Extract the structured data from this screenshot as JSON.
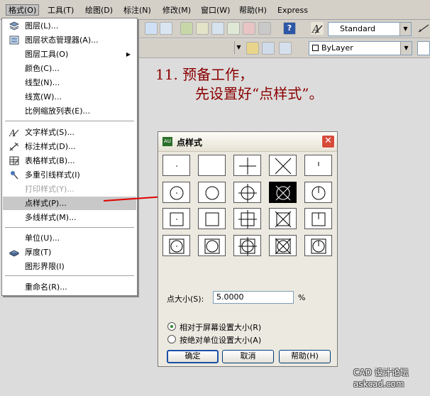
{
  "menubar": {
    "items": [
      {
        "label": "格式(O)"
      },
      {
        "label": "工具(T)"
      },
      {
        "label": "绘图(D)"
      },
      {
        "label": "标注(N)"
      },
      {
        "label": "修改(M)"
      },
      {
        "label": "窗口(W)"
      },
      {
        "label": "帮助(H)"
      },
      {
        "label": "Express"
      }
    ]
  },
  "toolbar": {
    "text_style": "Standard",
    "color": "ByLayer"
  },
  "format_menu": {
    "items": [
      {
        "label": "图层(L)...",
        "icon": "layers-icon"
      },
      {
        "label": "图层状态管理器(A)...",
        "icon": "layer-state-icon"
      },
      {
        "label": "图层工具(O)",
        "submenu": true
      },
      {
        "label": "颜色(C)..."
      },
      {
        "label": "线型(N)..."
      },
      {
        "label": "线宽(W)..."
      },
      {
        "label": "比例缩放列表(E)..."
      },
      {
        "label": "文字样式(S)...",
        "icon": "text-style-icon"
      },
      {
        "label": "标注样式(D)...",
        "icon": "dim-style-icon"
      },
      {
        "label": "表格样式(B)...",
        "icon": "table-style-icon"
      },
      {
        "label": "多重引线样式(I)",
        "icon": "mleader-style-icon"
      },
      {
        "label": "打印样式(Y)...",
        "disabled": true
      },
      {
        "label": "点样式(P)...",
        "highlighted": true
      },
      {
        "label": "多线样式(M)..."
      },
      {
        "label": "单位(U)..."
      },
      {
        "label": "厚度(T)",
        "icon": "thickness-icon"
      },
      {
        "label": "图形界限(I)"
      },
      {
        "label": "重命名(R)..."
      }
    ]
  },
  "annotation": {
    "line1": "11.  预备工作，",
    "line2": "先设置好“点样式”。"
  },
  "point_style_dialog": {
    "title": "点样式",
    "selected_style": "row 2, column 4",
    "point_size_label": "点大小(S):",
    "point_size_value": "5.0000",
    "point_size_unit": "%",
    "radio_relative": "相对于屏幕设置大小(R)",
    "radio_absolute": "按绝对单位设置大小(A)",
    "size_mode": "relative",
    "ok_button": "确定",
    "cancel_button": "取消",
    "help_button": "帮助(H)"
  },
  "watermark": {
    "line1": "CAD 设计论坛",
    "line2": "askcad.com"
  }
}
